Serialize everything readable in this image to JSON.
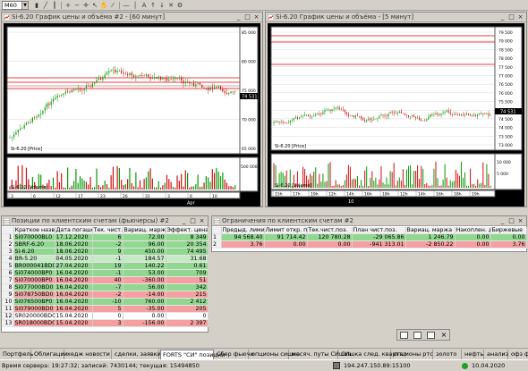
{
  "toolbar": {
    "timeframe": "M60"
  },
  "chart1": {
    "title": "Si-6.20 График цены и объёма #2 - [60 минут]",
    "price_axis": [
      "85 000",
      "80 000",
      "75 000",
      "70 000",
      "65 000"
    ],
    "current_price": "74 531",
    "price_label": "Si-6.20 [Price]",
    "volume_label": "Si-6.20 [Volume]",
    "volume_axis": [
      "500 000"
    ],
    "dates": [
      "3",
      "6",
      "12",
      "17",
      "23",
      "26",
      "31",
      "3",
      "6",
      "10"
    ],
    "month_label": "Apr"
  },
  "chart2": {
    "title": "Si-6.20 График цены и объёма - [5 минут]",
    "price_axis": [
      "79 500",
      "79 000",
      "78 500",
      "78 000",
      "77 500",
      "77 000",
      "76 500",
      "76 000",
      "75 500",
      "75 000",
      "74 500",
      "74 000",
      "73 500",
      "73 000"
    ],
    "current_price": "74 531",
    "price_label": "Si-6.20 [Price]",
    "volume_label": "Si-6.20 [Volume]",
    "volume_axis": [
      "10 000",
      "5 000"
    ],
    "times": [
      "15h",
      "17h",
      "19h",
      "12h",
      "14h",
      "16h",
      "18h",
      "12h",
      "14h",
      "16h",
      "18h",
      "19h"
    ],
    "date_label": "10"
  },
  "positions": {
    "title": "Позиции по клиентским счетам (фьючерсы) #2",
    "columns": [
      "Краткое название",
      "Дата погашения",
      "Тек. чист. поз.",
      "Вариац. маржа",
      "Эффект. цена"
    ],
    "rows": [
      {
        "n": "1",
        "name": "Si070000BL0",
        "date": "17.12.2020",
        "pos": "6",
        "margin": "72.00",
        "price": "8 349"
      },
      {
        "n": "2",
        "name": "SBRF-6.20",
        "date": "18.06.2020",
        "pos": "-2",
        "margin": "96.00",
        "price": "20 354"
      },
      {
        "n": "3",
        "name": "Si-6.20",
        "date": "18.06.2020",
        "pos": "9",
        "margin": "450.00",
        "price": "74 495"
      },
      {
        "n": "4",
        "name": "BR-5.20",
        "date": "04.05.2020",
        "pos": "-1",
        "margin": "184.57",
        "price": "31.68"
      },
      {
        "n": "5",
        "name": "BR000041BD0",
        "date": "27.04.2020",
        "pos": "19",
        "margin": "140.22",
        "price": "0.61"
      },
      {
        "n": "6",
        "name": "Si074000BP0",
        "date": "16.04.2020",
        "pos": "-1",
        "margin": "53.00",
        "price": "709"
      },
      {
        "n": "7",
        "name": "Si070000BP0",
        "date": "16.04.2020",
        "pos": "40",
        "margin": "-360.00",
        "price": "51"
      },
      {
        "n": "8",
        "name": "Si077000BD0",
        "date": "16.04.2020",
        "pos": "-7",
        "margin": "56.00",
        "price": "342"
      },
      {
        "n": "9",
        "name": "Si078750BD0",
        "date": "16.04.2020",
        "pos": "-2",
        "margin": "-14.00",
        "price": "215"
      },
      {
        "n": "10",
        "name": "Si076500BP0",
        "date": "16.04.2020",
        "pos": "-10",
        "margin": "760.00",
        "price": "2 412"
      },
      {
        "n": "11",
        "name": "Si079000BD0",
        "date": "16.04.2020",
        "pos": "5",
        "margin": "-35.00",
        "price": "205"
      },
      {
        "n": "12",
        "name": "SR020000BD0",
        "date": "15.04.2020",
        "pos": "0",
        "margin": "0.00",
        "price": "0"
      },
      {
        "n": "13",
        "name": "SR018000BD0",
        "date": "15.04.2020",
        "pos": "3",
        "margin": "-156.00",
        "price": "2 397"
      }
    ]
  },
  "limits": {
    "title": "Ограничения по клиентским счетам #2",
    "columns": [
      "Предыд. лимит",
      "Лимит откр. поз.",
      "Тек.чист.поз.",
      "План чист.поз.",
      "Вариац. маржа",
      "Накоплен. д",
      "Биржевые"
    ],
    "rows": [
      {
        "n": "1",
        "prev": "94 568.40",
        "lim": "91 714.42",
        "cur": "120 780.28",
        "plan": "-29 065.86",
        "margin": "1 246.79",
        "acc": "0.00",
        "ex": "0.00"
      },
      {
        "n": "2",
        "prev": "3.76",
        "lim": "0.00",
        "cur": "0.00",
        "plan": "-941 313.01",
        "margin": "-2 850.22",
        "acc": "0.00",
        "ex": "3.76"
      }
    ]
  },
  "tabs": [
    "Портфель",
    "Облигации",
    "хедж новости",
    "сделки, заявки",
    "FORTS \"СИ\" позиции",
    "Сбер фьючи",
    "опционы сишка",
    "месяч. путы СИшка",
    "СИшка след. квартал",
    "опционы ртс",
    "золото",
    "нефть",
    "анализ",
    "офз фьючи"
  ],
  "status": {
    "server_time": "Время сервера: 19:27:32; записей: 7430144; текущая: 15494850",
    "ip": "194.247.150.89:15100",
    "date": "10.04.2020"
  },
  "colors": {
    "green": "#90d890",
    "red": "#f4a0a0",
    "selected": "#c8e8c8"
  }
}
